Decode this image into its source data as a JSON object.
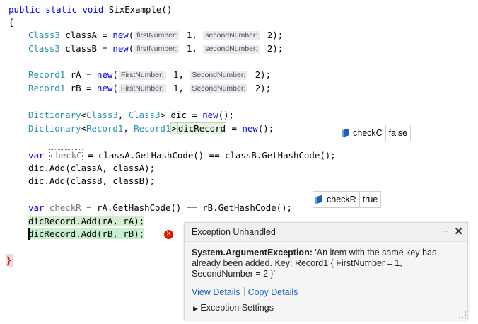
{
  "code": {
    "signature": {
      "kw1": "public",
      "kw2": "static",
      "kw3": "void",
      "name": "SixExample()"
    },
    "open_brace": "{",
    "close_brace": "}",
    "line_class_a": {
      "type": "Class3",
      "var": " classA = ",
      "kw": "new",
      "p1": "firstNumber:",
      "a1": " 1,",
      "p2": "secondNumber:",
      "a2": " 2);"
    },
    "line_class_b": {
      "type": "Class3",
      "var": " classB = ",
      "kw": "new",
      "p1": "firstNumber:",
      "a1": " 1,",
      "p2": "secondNumber:",
      "a2": " 2);"
    },
    "line_rec_a": {
      "type": "Record1",
      "var": " rA = ",
      "kw": "new",
      "p1": "FirstNumber:",
      "a1": " 1,",
      "p2": "SecondNumber:",
      "a2": " 2);"
    },
    "line_rec_b": {
      "type": "Record1",
      "var": " rB = ",
      "kw": "new",
      "p1": "FirstNumber:",
      "a1": " 1,",
      "p2": "SecondNumber:",
      "a2": " 2);"
    },
    "line_dic": {
      "t1": "Dictionary",
      "lt": "<",
      "t2": "Class3",
      "comma": ", ",
      "t3": "Class3",
      "rest": "> dic = ",
      "kw": "new",
      "end": "();"
    },
    "line_dicrec": {
      "t1": "Dictionary",
      "lt": "<",
      "t2": "Record1",
      "comma": ", ",
      "t3": "Record1",
      "gt": ">",
      "name": "dicRecord",
      "eq": " = ",
      "kw": "new",
      "end": "();"
    },
    "line_checkc": {
      "kw": "var",
      "name": "checkC",
      "rest": " = classA.GetHashCode() == classB.GetHashCode();"
    },
    "line_add1": "dic.Add(classA, classA);",
    "line_add2": "dic.Add(classB, classB);",
    "line_checkr": {
      "kw": "var",
      "name": "checkR",
      "rest": " = rA.GetHashCode() == rB.GetHashCode();"
    },
    "line_radd1": "dicRecord.Add(rA, rA);",
    "line_radd2": "dicRecord.Add(rB, rB);"
  },
  "datatips": {
    "checkC": {
      "name": "checkC",
      "value": "false"
    },
    "checkR": {
      "name": "checkR",
      "value": "true"
    }
  },
  "exception": {
    "title": "Exception Unhandled",
    "type": "System.ArgumentException:",
    "message": " 'An item with the same key has already been added. Key: Record1 { FirstNumber = 1, SecondNumber = 2 }'",
    "view_details": "View Details",
    "copy_details": "Copy Details",
    "settings": "Exception Settings",
    "pin": "⊣",
    "close": "✕"
  },
  "colors": {
    "keyword": "#0000ff",
    "type": "#2b91af",
    "error": "#e51400",
    "link": "#1a66c2"
  }
}
